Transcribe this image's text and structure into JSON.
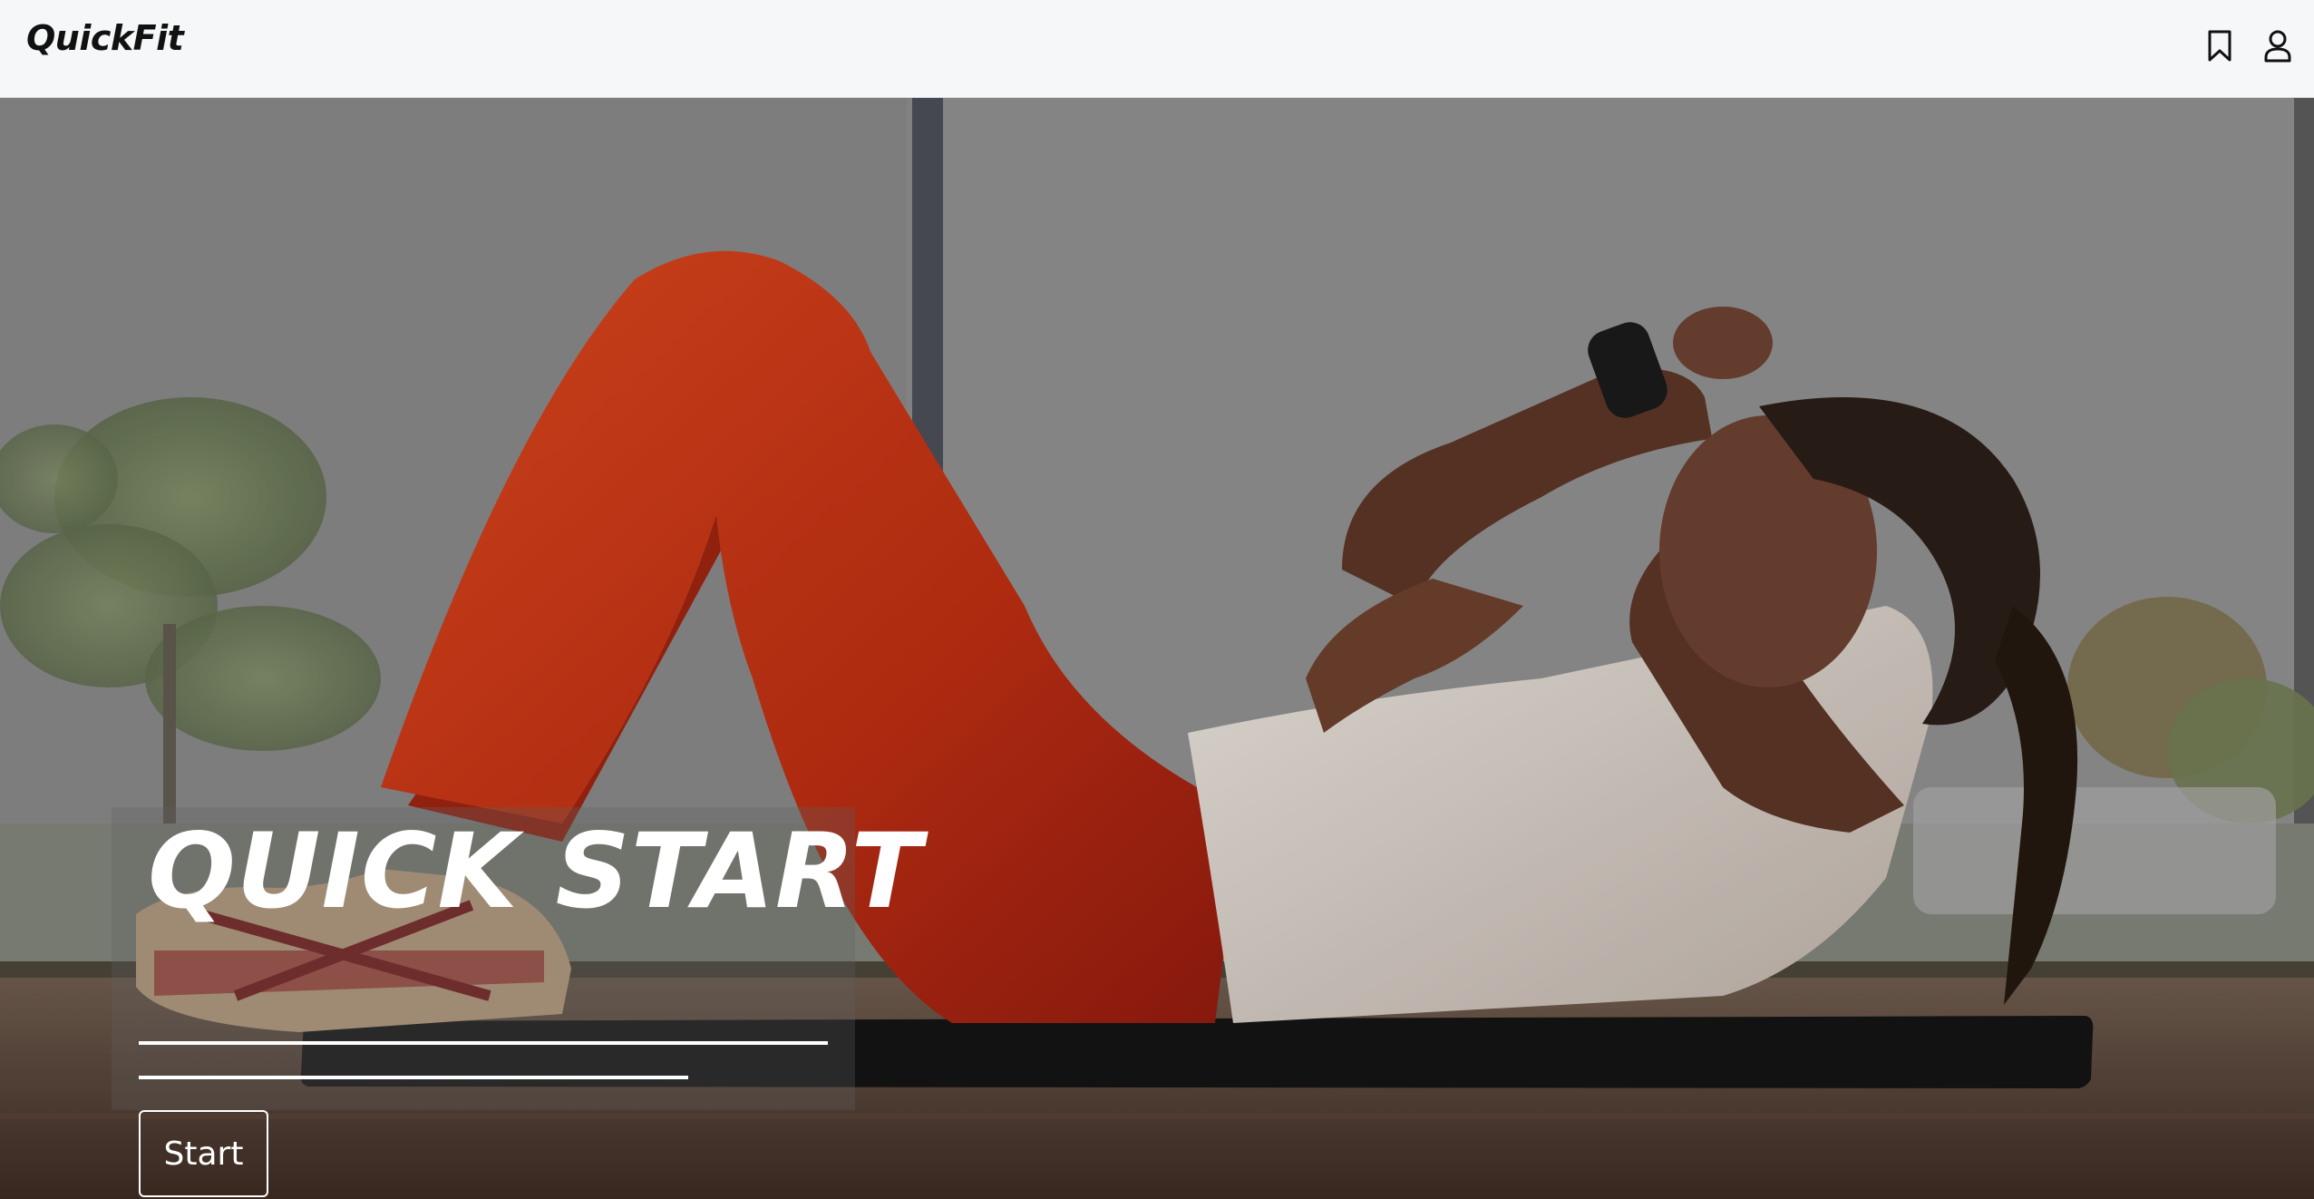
{
  "header": {
    "brand": "QuickFit",
    "bookmark_icon": "bookmark-icon",
    "account_icon": "user-icon"
  },
  "hero": {
    "image": "woman doing crunches on exercise mat",
    "title": "QUICK START",
    "start_label": "Start"
  },
  "colors": {
    "header_bg": "#f6f7f9",
    "text_dark": "#111111",
    "overlay_text": "#ffffff",
    "leggings": "#c9381a"
  }
}
